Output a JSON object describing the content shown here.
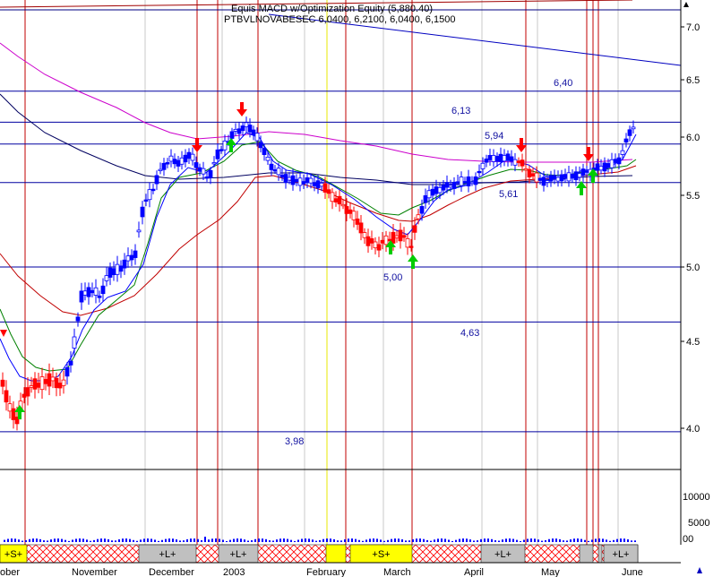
{
  "header": {
    "line1": "Equis   MACD   w/Optimization Equity (5,880.40)",
    "line2": "PTBVLNOVABESEC 6,0400, 6,2100, 6,0400, 6,1500"
  },
  "chart_data": {
    "type": "candlestick",
    "y_price_range": [
      3.75,
      7.4
    ],
    "y_ticks": [
      "7.0",
      "6.5",
      "6.0",
      "5.5",
      "5.0",
      "4.5",
      "4.0"
    ],
    "y_tick_values": [
      7.0,
      6.5,
      6.0,
      5.5,
      5.0,
      4.5,
      4.0
    ],
    "volume_ticks": [
      "10000",
      "5000"
    ],
    "volume_tick_values": [
      10000,
      5000
    ],
    "volume_label": "00",
    "x_labels": [
      "ober",
      "November",
      "December",
      "2003",
      "February",
      "March",
      "April",
      "May",
      "June"
    ],
    "levels": [
      {
        "label": "6,40",
        "value": 6.4
      },
      {
        "label": "6,13",
        "value": 6.13
      },
      {
        "label": "5,94",
        "value": 5.94
      },
      {
        "label": "5,61",
        "value": 5.61
      },
      {
        "label": "5,00",
        "value": 5.0
      },
      {
        "label": "4,63",
        "value": 4.63
      },
      {
        "label": "3,98",
        "value": 3.98
      }
    ],
    "signal_band": [
      {
        "label": "+S+",
        "type": "short"
      },
      {
        "label": "+L+",
        "type": "long"
      },
      {
        "label": "+L+",
        "type": "long"
      },
      {
        "label": "+S+",
        "type": "short"
      },
      {
        "label": "+L+",
        "type": "long"
      },
      {
        "label": "+L+",
        "type": "long"
      }
    ],
    "colors": {
      "up": "#0000ff",
      "down": "#ff0000",
      "ma_fast": "#0000ff",
      "ma_green": "#008000",
      "ma_red": "#c00000",
      "ma_navy": "#000060",
      "ma_magenta": "#cc00cc",
      "level": "#0000a0",
      "buy_arrow": "#00cc00",
      "sell_arrow": "#ff0000",
      "short_band": "#ffff00",
      "long_band": "#c0c0c0"
    }
  }
}
